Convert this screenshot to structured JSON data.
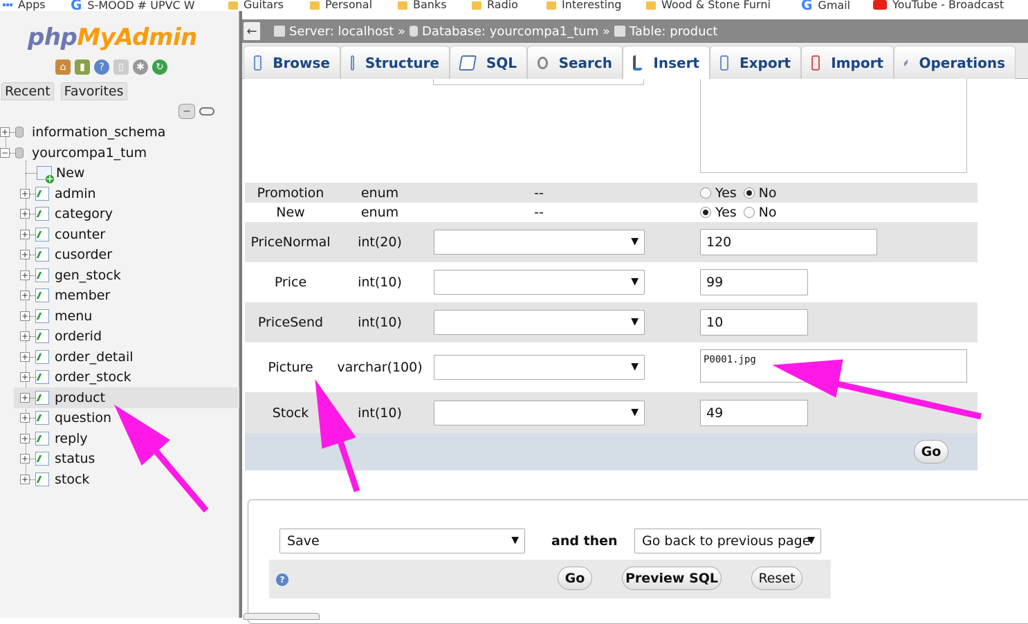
{
  "bookmarks": [
    {
      "label": "Apps",
      "icon": "apps-grid-icon"
    },
    {
      "label": "S-MOOD # UPVC W",
      "icon": "google-icon"
    },
    {
      "label": "Guitars",
      "icon": "folder-icon"
    },
    {
      "label": "Personal",
      "icon": "folder-icon"
    },
    {
      "label": "Banks",
      "icon": "folder-icon"
    },
    {
      "label": "Radio",
      "icon": "folder-icon"
    },
    {
      "label": "Interesting",
      "icon": "folder-icon"
    },
    {
      "label": "Wood & Stone Furni",
      "icon": "folder-icon"
    },
    {
      "label": "Gmail",
      "icon": "google-icon"
    },
    {
      "label": "YouTube - Broadcast",
      "icon": "youtube-icon"
    }
  ],
  "sidebar": {
    "logo_php": "php",
    "logo_myadmin": "MyAdmin",
    "tabs": [
      "Recent",
      "Favorites"
    ],
    "tree": {
      "databases": [
        {
          "name": "information_schema",
          "expander": "+"
        },
        {
          "name": "yourcompa1_tum",
          "expander": "−"
        }
      ],
      "new_label": "New",
      "tables": [
        "admin",
        "category",
        "counter",
        "cusorder",
        "gen_stock",
        "member",
        "menu",
        "orderid",
        "order_detail",
        "order_stock",
        "product",
        "question",
        "reply",
        "status",
        "stock"
      ],
      "active_table": "product"
    }
  },
  "header": {
    "back": "←",
    "server": "Server: localhost »",
    "database": "Database: yourcompa1_tum »",
    "table": "Table: product"
  },
  "tabs": [
    "Browse",
    "Structure",
    "SQL",
    "Search",
    "Insert",
    "Export",
    "Import",
    "Operations"
  ],
  "active_tab": "Insert",
  "form": {
    "rows": [
      {
        "column": "Promotion",
        "type": "enum",
        "null": "--",
        "kind": "radio",
        "options": [
          "Yes",
          "No"
        ],
        "selected": "No"
      },
      {
        "column": "New",
        "type": "enum",
        "null": "--",
        "kind": "radio",
        "options": [
          "Yes",
          "No"
        ],
        "selected": "Yes"
      },
      {
        "column": "PriceNormal",
        "type": "int(20)",
        "kind": "input",
        "value": "120"
      },
      {
        "column": "Price",
        "type": "int(10)",
        "kind": "input",
        "value": "99"
      },
      {
        "column": "PriceSend",
        "type": "int(10)",
        "kind": "input",
        "value": "10"
      },
      {
        "column": "Picture",
        "type": "varchar(100)",
        "kind": "textarea",
        "value": "P0001.jpg"
      },
      {
        "column": "Stock",
        "type": "int(10)",
        "kind": "input",
        "value": "49"
      }
    ],
    "go_label": "Go"
  },
  "bottom": {
    "action_select": "Save",
    "and_then": "and then",
    "after_select": "Go back to previous page",
    "go": "Go",
    "preview_sql": "Preview SQL",
    "reset": "Reset"
  },
  "colors": {
    "annotation_arrow": "#ff19e6",
    "tab_text": "#1a4683",
    "logo_php": "#6c78af",
    "logo_myadmin": "#f89c0e"
  }
}
